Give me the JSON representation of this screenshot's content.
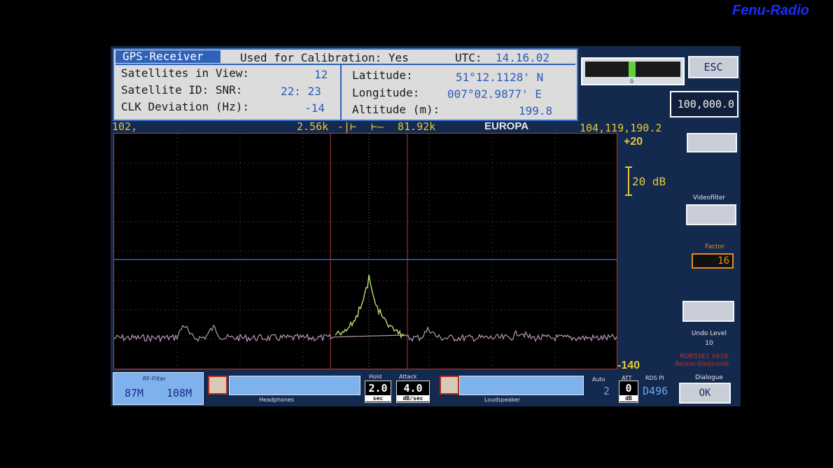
{
  "watermark": "Fenu-Radio",
  "gps": {
    "tab": "GPS-Receiver",
    "calibration": "Used for Calibration: Yes",
    "utc_label": "UTC:",
    "utc_value": "14.16.02",
    "satellites_label": "Satellites in View:",
    "satellites_value": "12",
    "sat_id_label": "Satellite ID: SNR:",
    "sat_id_value": "22: 23",
    "clk_label": "CLK Deviation (Hz):",
    "clk_value": "-14",
    "lat_label": "Latitude:",
    "lat_value": "51°12.1128' N",
    "lon_label": "Longitude:",
    "lon_value": "007°02.9877' E",
    "alt_label": "Altitude (m):",
    "alt_value": "199.8"
  },
  "scale": {
    "left": "102,",
    "span1": "2.56k",
    "span2": "81.92k",
    "region": "EUROPA",
    "right": "104,119,190.2"
  },
  "y_axis": {
    "top": "+20",
    "div": "20 dB",
    "bottom": "-140"
  },
  "sidebar": {
    "esc": "ESC",
    "freq": "100,000.0",
    "videofilter": "Videofilter",
    "factor_label": "Factor",
    "factor_value": "16",
    "undo_label": "Undo Level",
    "undo_value": "10",
    "version": "RDR55E1 V610",
    "maker": "Reuter-Elektronik",
    "dialogue": "Dialogue",
    "ok": "OK",
    "meter_center": "0"
  },
  "bottom": {
    "rf_filter": "RF-Filter",
    "rf_low": "87M",
    "rf_high": "108M",
    "headphones": "Headphones",
    "hold_label": "Hold",
    "hold_value": "2.0",
    "hold_unit": "sec",
    "attack_label": "Attack",
    "attack_value": "4.0",
    "attack_unit": "dB/sec",
    "loudspeaker": "Loudspeaker",
    "auto_label": "Auto",
    "auto_value": "2",
    "att_label": "ATT",
    "att_value": "0",
    "att_unit": "dB",
    "rds_label": "RDS PI",
    "rds_value": "D496"
  },
  "colors": {
    "trace_noise": "#b89ab8",
    "trace_signal": "#b8e070",
    "ref_line": "#3a5cc8",
    "marker": "#b04030"
  }
}
